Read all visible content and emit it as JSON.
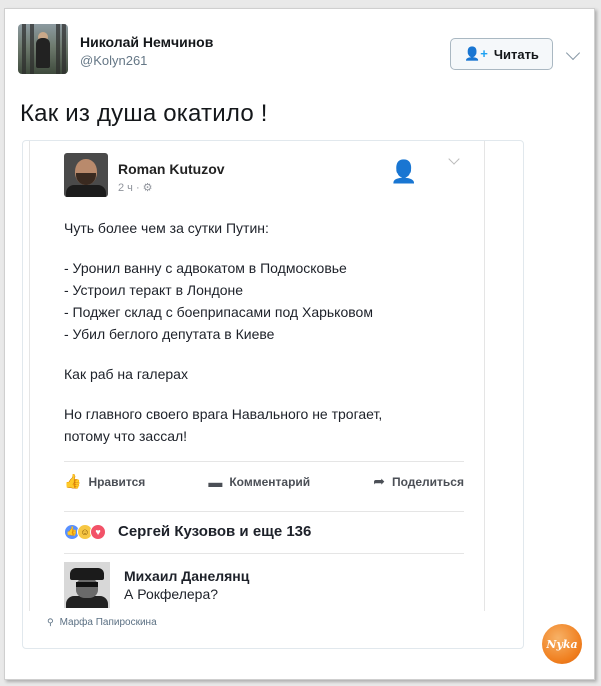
{
  "tweet": {
    "author_name": "Николай Немчинов",
    "author_handle": "@Kolyn261",
    "follow_label": "Читать",
    "text": "Как из душа окатило !"
  },
  "fb_post": {
    "author_name": "Roman Kutuzov",
    "meta": "2 ч · ⚙",
    "lines": [
      "Чуть более чем за сутки Путин:",
      "",
      "- Уронил ванну с адвокатом в Подмосковье",
      "- Устроил теракт в Лондоне",
      "- Поджег склад с боеприпасами под Харьковом",
      "- Убил беглого депутата в Киеве",
      "",
      "Как раб на галерах",
      "",
      "Но главного своего врага Навального не трогает,",
      "потому что зассал!"
    ],
    "actions": {
      "like": "Нравится",
      "comment": "Комментарий",
      "share": "Поделиться"
    },
    "reactions_text": "Сергей Кузовов и еще 136",
    "comment": {
      "author": "Михаил Данелянц",
      "text": "А Рокфелера?"
    }
  },
  "credit": "Марфа Папироскина",
  "watermark": "Nyka"
}
